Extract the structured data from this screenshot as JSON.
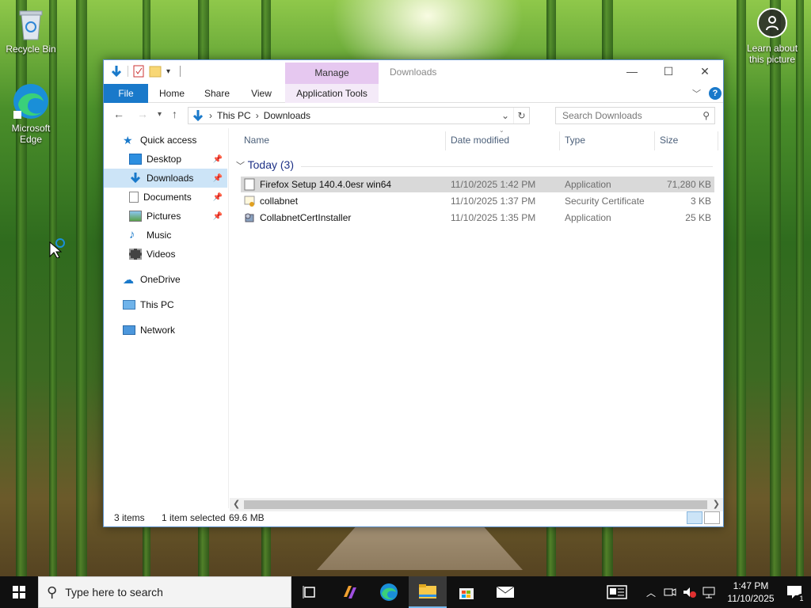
{
  "desktop": {
    "icons": [
      {
        "label": "Recycle Bin",
        "icon": "recycle-bin-icon"
      },
      {
        "label": "Microsoft Edge",
        "icon": "edge-icon"
      }
    ],
    "learn_label": "Learn about this picture"
  },
  "window": {
    "title": "Downloads",
    "manage_tab": "Manage",
    "caption": {
      "minimize": "—",
      "maximize": "☐",
      "close": "✕"
    },
    "ribbon_tabs": {
      "file": "File",
      "home": "Home",
      "share": "Share",
      "view": "View",
      "app_tools": "Application Tools"
    },
    "help": "?",
    "address": {
      "segments": [
        "This PC",
        "Downloads"
      ]
    },
    "search_placeholder": "Search Downloads",
    "nav_pane": {
      "quick_access": "Quick access",
      "items": [
        {
          "label": "Desktop",
          "pinned": true
        },
        {
          "label": "Downloads",
          "pinned": true
        },
        {
          "label": "Documents",
          "pinned": true
        },
        {
          "label": "Pictures",
          "pinned": true
        },
        {
          "label": "Music",
          "pinned": false
        },
        {
          "label": "Videos",
          "pinned": false
        }
      ],
      "onedrive": "OneDrive",
      "this_pc": "This PC",
      "network": "Network"
    },
    "columns": {
      "name": "Name",
      "date": "Date modified",
      "type": "Type",
      "size": "Size"
    },
    "group": "Today (3)",
    "files": [
      {
        "name": "Firefox Setup 140.4.0esr win64",
        "date": "11/10/2025 1:42 PM",
        "type": "Application",
        "size": "71,280 KB",
        "icon": "application-file-icon",
        "selected": true
      },
      {
        "name": "collabnet",
        "date": "11/10/2025 1:37 PM",
        "type": "Security Certificate",
        "size": "3 KB",
        "icon": "certificate-icon",
        "selected": false
      },
      {
        "name": "CollabnetCertInstaller",
        "date": "11/10/2025 1:35 PM",
        "type": "Application",
        "size": "25 KB",
        "icon": "installer-icon",
        "selected": false
      }
    ],
    "status": {
      "items": "3 items",
      "selected": "1 item selected",
      "size": "69.6 MB"
    }
  },
  "taskbar": {
    "search_placeholder": "Type here to search",
    "apps": [
      "task-view-icon",
      "copilot-icon",
      "edge-icon",
      "file-explorer-icon",
      "store-icon",
      "mail-icon"
    ],
    "clock": {
      "time": "1:47 PM",
      "date": "11/10/2025"
    },
    "notification_count": "1"
  }
}
